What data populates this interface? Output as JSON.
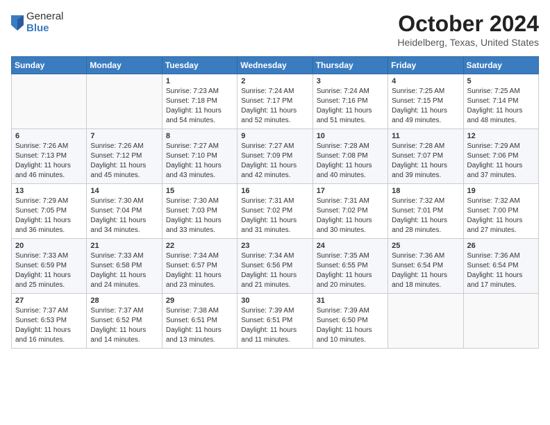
{
  "logo": {
    "general": "General",
    "blue": "Blue"
  },
  "title": "October 2024",
  "location": "Heidelberg, Texas, United States",
  "weekdays": [
    "Sunday",
    "Monday",
    "Tuesday",
    "Wednesday",
    "Thursday",
    "Friday",
    "Saturday"
  ],
  "weeks": [
    [
      {
        "day": "",
        "info": ""
      },
      {
        "day": "",
        "info": ""
      },
      {
        "day": "1",
        "info": "Sunrise: 7:23 AM\nSunset: 7:18 PM\nDaylight: 11 hours and 54 minutes."
      },
      {
        "day": "2",
        "info": "Sunrise: 7:24 AM\nSunset: 7:17 PM\nDaylight: 11 hours and 52 minutes."
      },
      {
        "day": "3",
        "info": "Sunrise: 7:24 AM\nSunset: 7:16 PM\nDaylight: 11 hours and 51 minutes."
      },
      {
        "day": "4",
        "info": "Sunrise: 7:25 AM\nSunset: 7:15 PM\nDaylight: 11 hours and 49 minutes."
      },
      {
        "day": "5",
        "info": "Sunrise: 7:25 AM\nSunset: 7:14 PM\nDaylight: 11 hours and 48 minutes."
      }
    ],
    [
      {
        "day": "6",
        "info": "Sunrise: 7:26 AM\nSunset: 7:13 PM\nDaylight: 11 hours and 46 minutes."
      },
      {
        "day": "7",
        "info": "Sunrise: 7:26 AM\nSunset: 7:12 PM\nDaylight: 11 hours and 45 minutes."
      },
      {
        "day": "8",
        "info": "Sunrise: 7:27 AM\nSunset: 7:10 PM\nDaylight: 11 hours and 43 minutes."
      },
      {
        "day": "9",
        "info": "Sunrise: 7:27 AM\nSunset: 7:09 PM\nDaylight: 11 hours and 42 minutes."
      },
      {
        "day": "10",
        "info": "Sunrise: 7:28 AM\nSunset: 7:08 PM\nDaylight: 11 hours and 40 minutes."
      },
      {
        "day": "11",
        "info": "Sunrise: 7:28 AM\nSunset: 7:07 PM\nDaylight: 11 hours and 39 minutes."
      },
      {
        "day": "12",
        "info": "Sunrise: 7:29 AM\nSunset: 7:06 PM\nDaylight: 11 hours and 37 minutes."
      }
    ],
    [
      {
        "day": "13",
        "info": "Sunrise: 7:29 AM\nSunset: 7:05 PM\nDaylight: 11 hours and 36 minutes."
      },
      {
        "day": "14",
        "info": "Sunrise: 7:30 AM\nSunset: 7:04 PM\nDaylight: 11 hours and 34 minutes."
      },
      {
        "day": "15",
        "info": "Sunrise: 7:30 AM\nSunset: 7:03 PM\nDaylight: 11 hours and 33 minutes."
      },
      {
        "day": "16",
        "info": "Sunrise: 7:31 AM\nSunset: 7:02 PM\nDaylight: 11 hours and 31 minutes."
      },
      {
        "day": "17",
        "info": "Sunrise: 7:31 AM\nSunset: 7:02 PM\nDaylight: 11 hours and 30 minutes."
      },
      {
        "day": "18",
        "info": "Sunrise: 7:32 AM\nSunset: 7:01 PM\nDaylight: 11 hours and 28 minutes."
      },
      {
        "day": "19",
        "info": "Sunrise: 7:32 AM\nSunset: 7:00 PM\nDaylight: 11 hours and 27 minutes."
      }
    ],
    [
      {
        "day": "20",
        "info": "Sunrise: 7:33 AM\nSunset: 6:59 PM\nDaylight: 11 hours and 25 minutes."
      },
      {
        "day": "21",
        "info": "Sunrise: 7:33 AM\nSunset: 6:58 PM\nDaylight: 11 hours and 24 minutes."
      },
      {
        "day": "22",
        "info": "Sunrise: 7:34 AM\nSunset: 6:57 PM\nDaylight: 11 hours and 23 minutes."
      },
      {
        "day": "23",
        "info": "Sunrise: 7:34 AM\nSunset: 6:56 PM\nDaylight: 11 hours and 21 minutes."
      },
      {
        "day": "24",
        "info": "Sunrise: 7:35 AM\nSunset: 6:55 PM\nDaylight: 11 hours and 20 minutes."
      },
      {
        "day": "25",
        "info": "Sunrise: 7:36 AM\nSunset: 6:54 PM\nDaylight: 11 hours and 18 minutes."
      },
      {
        "day": "26",
        "info": "Sunrise: 7:36 AM\nSunset: 6:54 PM\nDaylight: 11 hours and 17 minutes."
      }
    ],
    [
      {
        "day": "27",
        "info": "Sunrise: 7:37 AM\nSunset: 6:53 PM\nDaylight: 11 hours and 16 minutes."
      },
      {
        "day": "28",
        "info": "Sunrise: 7:37 AM\nSunset: 6:52 PM\nDaylight: 11 hours and 14 minutes."
      },
      {
        "day": "29",
        "info": "Sunrise: 7:38 AM\nSunset: 6:51 PM\nDaylight: 11 hours and 13 minutes."
      },
      {
        "day": "30",
        "info": "Sunrise: 7:39 AM\nSunset: 6:51 PM\nDaylight: 11 hours and 11 minutes."
      },
      {
        "day": "31",
        "info": "Sunrise: 7:39 AM\nSunset: 6:50 PM\nDaylight: 11 hours and 10 minutes."
      },
      {
        "day": "",
        "info": ""
      },
      {
        "day": "",
        "info": ""
      }
    ]
  ]
}
